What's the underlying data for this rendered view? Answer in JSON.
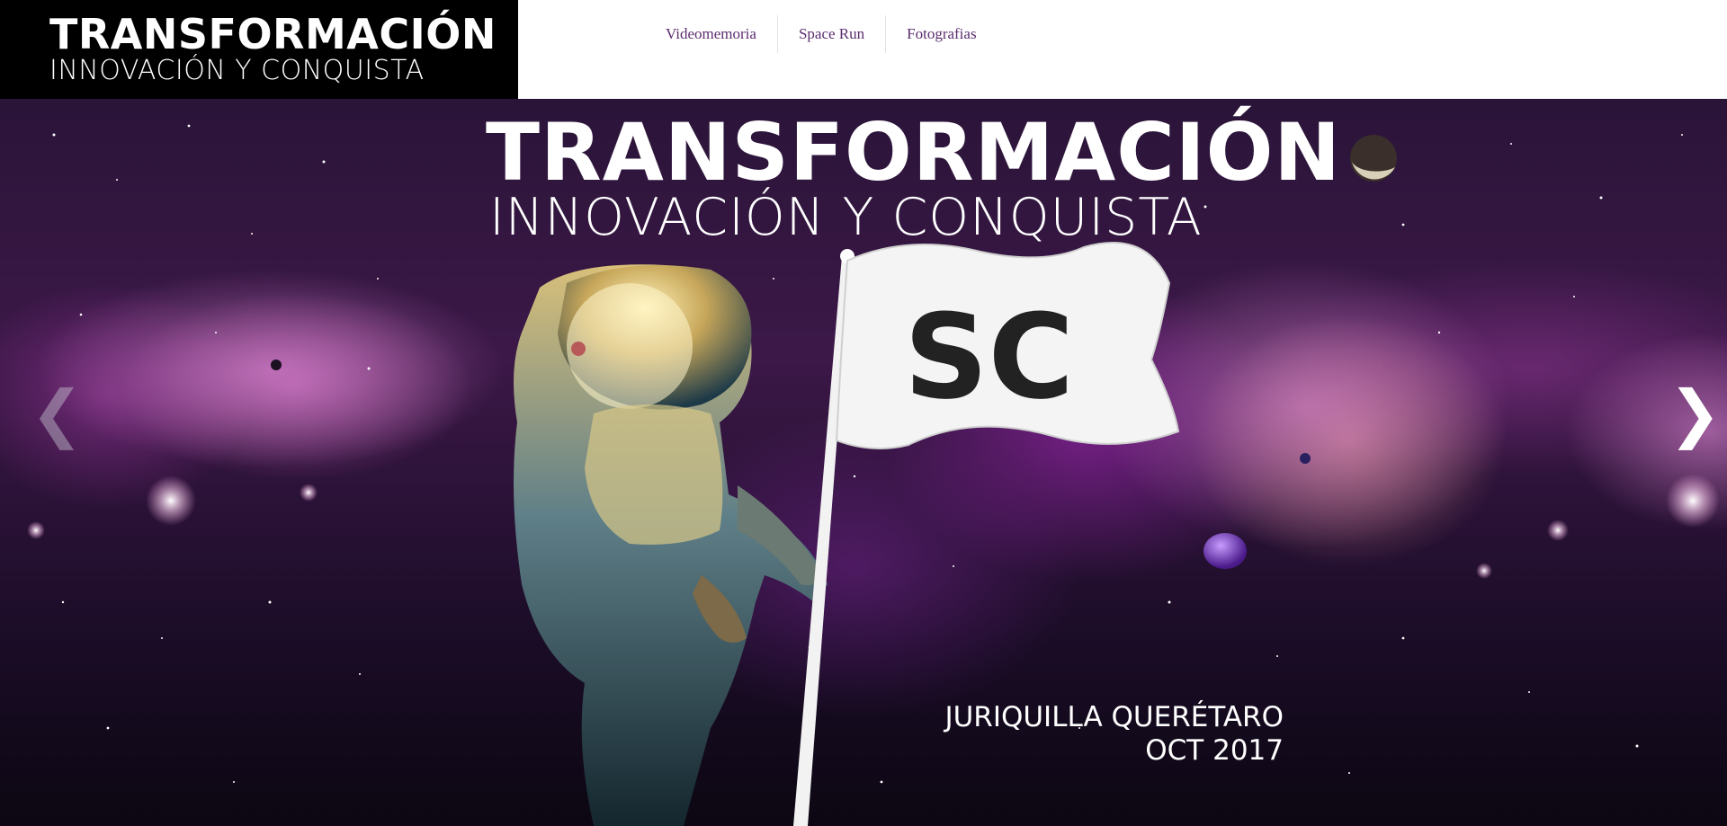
{
  "header": {
    "logo": {
      "title": "TRANSFORMACIÓN",
      "subtitle": "INNOVACIÓN Y CONQUISTA"
    },
    "nav": [
      {
        "label": "Videomemoria"
      },
      {
        "label": "Space Run"
      },
      {
        "label": "Fotografias"
      }
    ]
  },
  "hero": {
    "title": "TRANSFORMACIÓN",
    "subtitle": "INNOVACIÓN Y CONQUISTA",
    "flag_text": "SC",
    "location": "JURIQUILLA QUERÉTARO",
    "date": "OCT 2017",
    "prev_icon": "❮",
    "next_icon": "❯"
  },
  "colors": {
    "nav_link": "#5b2c6f",
    "logo_background": "#000000",
    "header_background": "#ffffff"
  }
}
